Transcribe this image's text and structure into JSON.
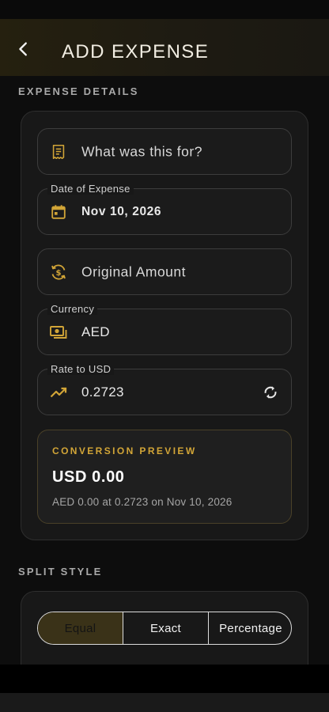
{
  "header": {
    "title": "ADD EXPENSE",
    "back_icon": "chevron-left-icon"
  },
  "sections": {
    "details_label": "EXPENSE DETAILS",
    "split_label": "SPLIT STYLE"
  },
  "fields": {
    "description": {
      "placeholder": "What was this for?",
      "icon": "receipt-icon"
    },
    "date": {
      "label": "Date of Expense",
      "value": "Nov 10, 2026",
      "icon": "calendar-icon"
    },
    "amount": {
      "placeholder": "Original Amount",
      "icon": "currency-exchange-icon"
    },
    "currency": {
      "label": "Currency",
      "value": "AED",
      "icon": "cash-icon"
    },
    "rate": {
      "label": "Rate to USD",
      "value": "0.2723",
      "icon": "trending-up-icon",
      "action_icon": "refresh-icon"
    }
  },
  "conversion_preview": {
    "label": "CONVERSION PREVIEW",
    "amount": "USD 0.00",
    "note": "AED 0.00 at 0.2723 on Nov 10, 2026"
  },
  "split": {
    "options": [
      "Equal",
      "Exact",
      "Percentage"
    ],
    "selected": "Equal"
  },
  "colors": {
    "accent": "#d2a537",
    "background": "#0d0d0d",
    "card": "#181818",
    "header": "#25200f"
  }
}
